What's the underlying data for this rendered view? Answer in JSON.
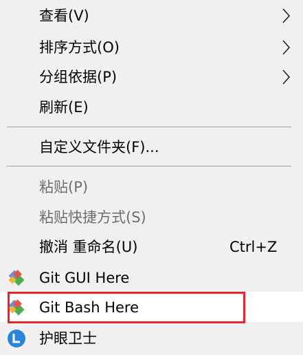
{
  "menu": {
    "items": [
      {
        "label": "查看(V)",
        "submenu": true
      },
      {
        "label": "排序方式(O)",
        "submenu": true
      },
      {
        "label": "分组依据(P)",
        "submenu": true
      },
      {
        "label": "刷新(E)"
      },
      {
        "label": "自定义文件夹(F)..."
      },
      {
        "label": "粘贴(P)",
        "disabled": true
      },
      {
        "label": "粘贴快捷方式(S)",
        "disabled": true
      },
      {
        "label": "撤消 重命名(U)",
        "shortcut": "Ctrl+Z"
      },
      {
        "label": "Git GUI Here",
        "icon": "git-gui-icon"
      },
      {
        "label": "Git Bash Here",
        "icon": "git-bash-icon",
        "highlighted": true
      },
      {
        "label": "护眼卫士",
        "icon": "eye-guard-icon"
      }
    ],
    "highlight_color": "#e8232b"
  }
}
